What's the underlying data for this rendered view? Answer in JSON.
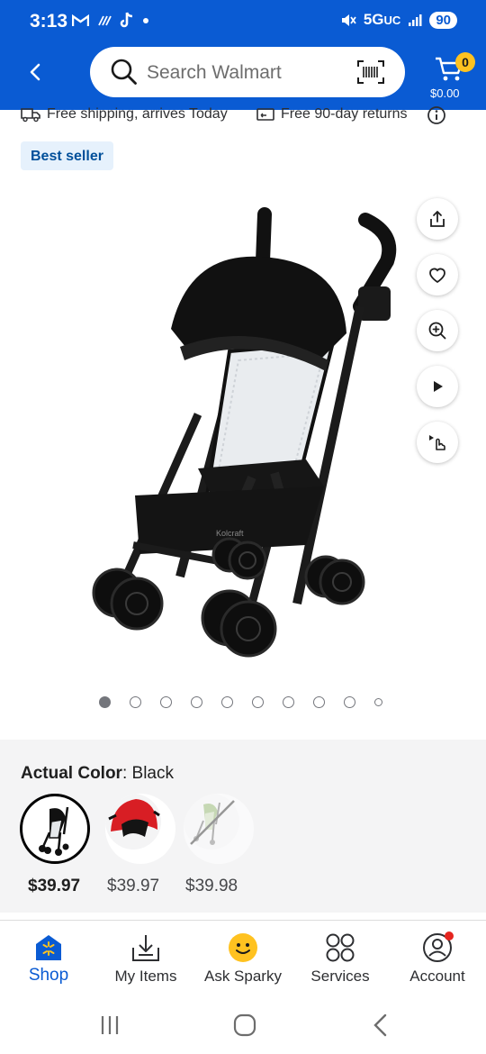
{
  "status_bar": {
    "time": "3:13",
    "network": "5G",
    "network_sub": "UC",
    "battery": "90"
  },
  "header": {
    "search_placeholder": "Search Walmart",
    "cart_count": "0",
    "cart_total": "$0.00",
    "brand_color": "#0a5bd3",
    "badge_color": "#ffc220"
  },
  "shipping": {
    "delivery": "Free shipping, arrives Today",
    "returns": "Free 90-day returns"
  },
  "product": {
    "badge": "Best seller",
    "brand_mark": "Kolcraft",
    "image_count": 10,
    "active_image_index": 0
  },
  "color_picker": {
    "label": "Actual Color",
    "selected": "Black",
    "options": [
      {
        "name": "Black",
        "price": "$39.97",
        "selected": true
      },
      {
        "name": "Red",
        "price": "$39.97",
        "selected": false
      },
      {
        "name": "Green",
        "price": "$39.98",
        "selected": false,
        "unavailable": true
      }
    ]
  },
  "bottom_nav": {
    "items": [
      {
        "label": "Shop",
        "active": true
      },
      {
        "label": "My Items",
        "active": false
      },
      {
        "label": "Ask Sparky",
        "active": false
      },
      {
        "label": "Services",
        "active": false
      },
      {
        "label": "Account",
        "active": false
      }
    ]
  }
}
